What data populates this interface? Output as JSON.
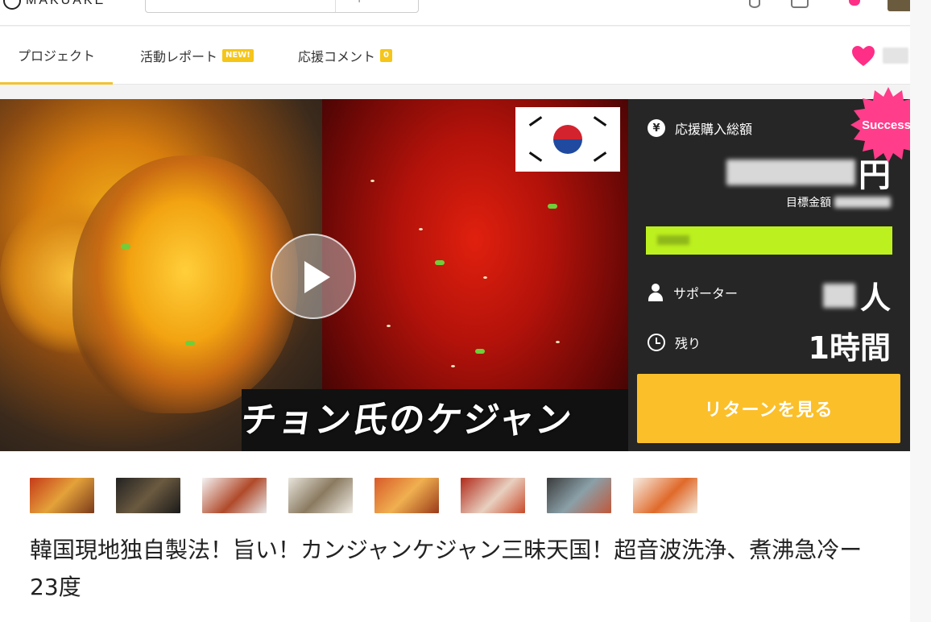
{
  "header": {
    "logo_text": "MAKUAKE",
    "icons": [
      "logo-icon",
      "search-icon",
      "location-icon",
      "inbox-icon",
      "notification-icon",
      "avatar"
    ]
  },
  "tabs": [
    {
      "label": "プロジェクト",
      "active": true
    },
    {
      "label": "活動レポート",
      "badge": "NEW!"
    },
    {
      "label": "応援コメント",
      "badge": "0"
    }
  ],
  "hero": {
    "caption": "チョン氏のケジャン",
    "flag_icon": "korea-flag-icon",
    "play_icon": "play-icon"
  },
  "panel": {
    "total_label": "応援購入総額",
    "total_currency": "円",
    "goal_label": "目標金額",
    "supporters_label": "サポーター",
    "supporters_unit": "人",
    "remaining_label": "残り",
    "remaining_value": "1時間",
    "return_button": "リターンを見る",
    "success_badge": "Success!",
    "colors": {
      "panel_bg": "#262626",
      "progress": "#bdf01f",
      "button": "#fbbf2a",
      "badge": "#ff3d8a"
    }
  },
  "project_title": "韓国現地独自製法！旨い！カンジャンケジャン三昧天国！超音波洗浄、煮沸急冷ー23度",
  "thumbnails": [
    {
      "alt": "thumbnail-1"
    },
    {
      "alt": "thumbnail-2"
    },
    {
      "alt": "thumbnail-3"
    },
    {
      "alt": "thumbnail-4"
    },
    {
      "alt": "thumbnail-5"
    },
    {
      "alt": "thumbnail-6"
    },
    {
      "alt": "thumbnail-7"
    },
    {
      "alt": "thumbnail-8"
    }
  ]
}
